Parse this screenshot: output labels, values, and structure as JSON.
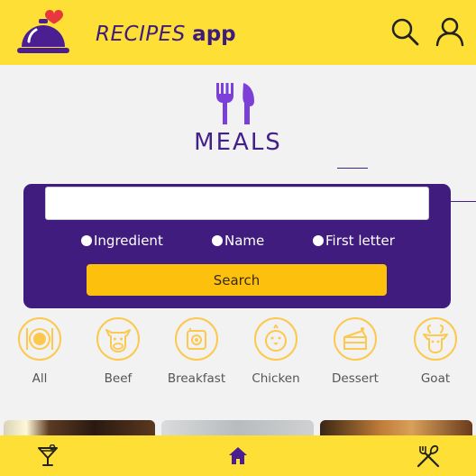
{
  "header": {
    "title_part1": "RECIPES",
    "title_part2": "app",
    "icons": [
      "cloche-heart-logo",
      "search-icon",
      "profile-icon"
    ]
  },
  "main": {
    "page_icon": "fork-knife-icon",
    "page_title": "MEALS"
  },
  "search": {
    "input_value": "",
    "placeholder": "",
    "options": [
      {
        "label": "Ingredient"
      },
      {
        "label": "Name"
      },
      {
        "label": "First letter"
      }
    ],
    "button_label": "Search"
  },
  "categories": [
    {
      "label": "All",
      "icon": "plate-icon"
    },
    {
      "label": "Beef",
      "icon": "cow-icon"
    },
    {
      "label": "Breakfast",
      "icon": "toaster-icon"
    },
    {
      "label": "Chicken",
      "icon": "chick-icon"
    },
    {
      "label": "Dessert",
      "icon": "cake-icon"
    },
    {
      "label": "Goat",
      "icon": "goat-icon"
    }
  ],
  "footer": {
    "icons": [
      "cocktail-icon",
      "home-icon",
      "cutlery-icon"
    ]
  },
  "colors": {
    "header_bg": "#fddf36",
    "brand_purple": "#401c7e",
    "button_yellow": "#fdc10d",
    "category_ring": "#fcc84d"
  }
}
